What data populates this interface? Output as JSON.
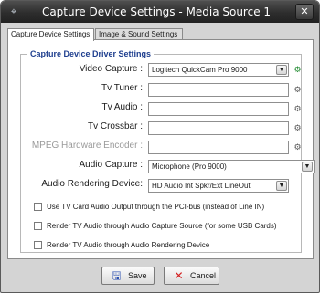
{
  "window": {
    "title": "Capture Device Settings - Media Source 1",
    "app_icon": "signal-icon",
    "close_glyph": "✕"
  },
  "tabs": [
    {
      "label": "Capture Device Settings",
      "active": true
    },
    {
      "label": "Image & Sound Settings",
      "active": false
    }
  ],
  "group": {
    "title": "Capture Device Driver Settings",
    "fields": [
      {
        "label": "Video Capture :",
        "value": "Logitech QuickCam Pro 9000",
        "type": "select",
        "icon": "settings-icon"
      },
      {
        "label": "Tv Tuner :",
        "value": "",
        "type": "text",
        "icon": "settings-icon"
      },
      {
        "label": "Tv Audio :",
        "value": "",
        "type": "text",
        "icon": "settings-icon"
      },
      {
        "label": "Tv Crossbar :",
        "value": "",
        "type": "text",
        "icon": "settings-icon"
      },
      {
        "label": "MPEG Hardware Encoder :",
        "value": "",
        "type": "text",
        "icon": "settings-icon",
        "disabled": true
      },
      {
        "label": "Audio Capture :",
        "value": "Microphone (Pro 9000)",
        "type": "select"
      },
      {
        "label": "Audio Rendering  Device:",
        "value": "HD Audio Int Spkr/Ext LineOut",
        "type": "select"
      }
    ],
    "checkboxes": [
      {
        "label": "Use TV Card Audio Output through the PCI-bus (instead of Line IN)",
        "checked": false
      },
      {
        "label": "Render TV Audio through Audio Capture Source (for some USB Cards)",
        "checked": false
      },
      {
        "label": "Render TV Audio through Audio Rendering Device",
        "checked": false
      }
    ]
  },
  "buttons": {
    "save_label": "Save",
    "cancel_label": "Cancel",
    "save_icon": "floppy-disk-icon",
    "cancel_icon": "close-x-icon"
  },
  "colors": {
    "titlebar": "#2d2d2d",
    "group_title": "#1f3f8f",
    "cancel_icon": "#d42020",
    "save_icon": "#2a4fb0"
  }
}
